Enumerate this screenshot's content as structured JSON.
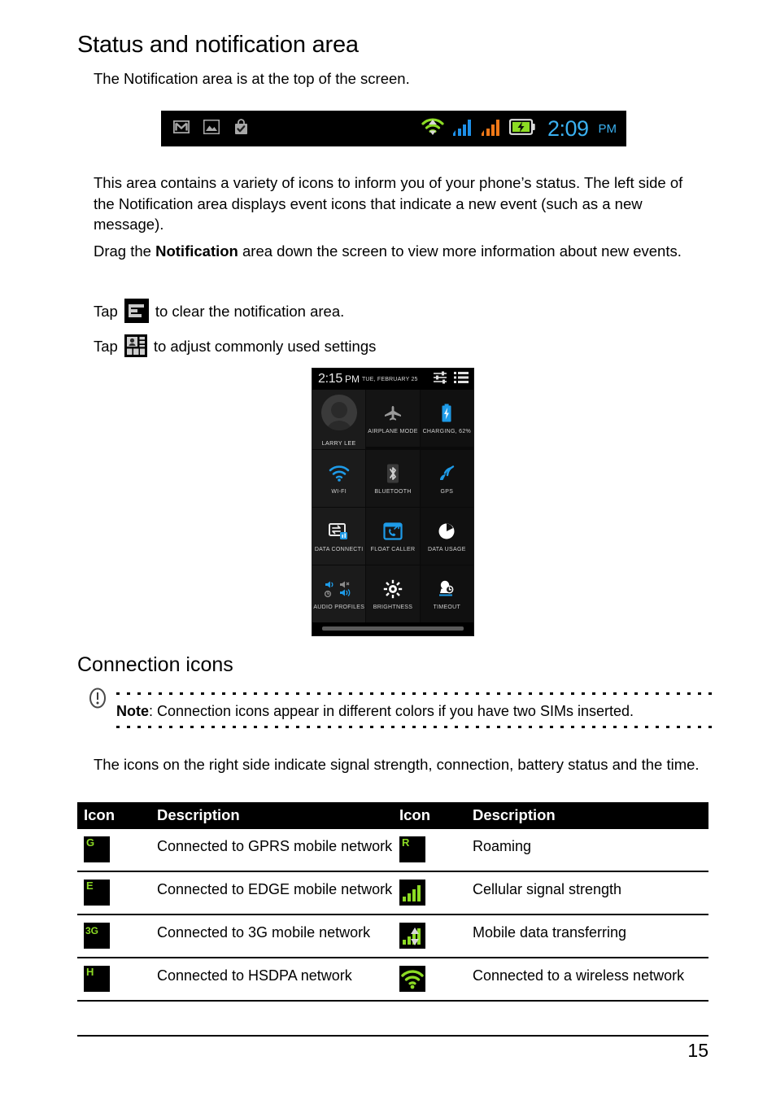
{
  "document": {
    "title": "Status and notification area",
    "intro": "The Notification area is at the top of the screen.",
    "paragraph_1": "This area contains a variety of icons to inform you of your phone’s status. The left side of the Notification area displays event icons that indicate a new event (such as a new message).",
    "paragraph_2_prefix": "Drag the ",
    "paragraph_2_bold": "Notification",
    "paragraph_2_suffix": " area down the screen to view more information about new events.",
    "tap_prefix": "Tap",
    "tap_clear_text": "to clear the notification area.",
    "tap_settings_text": "to adjust commonly used settings",
    "section_title": "Connection icons",
    "note_label": "Note",
    "note_text": ": Connection icons appear in different colors if you have two SIMs inserted.",
    "after_note": "The icons on the right side indicate signal strength, connection, battery status and the time.",
    "page_number": "15"
  },
  "statusbar": {
    "time": "2:09",
    "ampm": "PM",
    "time_color": "#3ab0f0",
    "left_icons": [
      "gmail-icon",
      "gallery-icon",
      "play-store-bag-icon"
    ],
    "right_icons": [
      "wifi-icon",
      "signal-sim1-icon",
      "signal-sim2-icon",
      "battery-charging-icon"
    ],
    "wifi_color": "#8cdb24",
    "sim1_color": "#1e90e8",
    "sim2_color": "#f07818",
    "battery_color": "#8cdb24"
  },
  "quick_settings": {
    "time": "2:15",
    "ampm": "PM",
    "date": "TUE, FEBRUARY 25",
    "header_icons": [
      "settings-sliders-icon",
      "notification-list-icon"
    ],
    "tiles": [
      {
        "label": "LARRY LEE",
        "icon": "user-avatar-icon",
        "accent": "#9a9a9a"
      },
      {
        "label": "AIRPLANE MODE",
        "icon": "airplane-icon",
        "accent": "#9a9a9a"
      },
      {
        "label": "CHARGING, 62%",
        "icon": "battery-charging-icon",
        "accent": "#1e9be8"
      },
      {
        "label": "WI-FI",
        "icon": "wifi-icon",
        "accent": "#1e9be8"
      },
      {
        "label": "BLUETOOTH",
        "icon": "bluetooth-icon",
        "accent": "#8a8a8a"
      },
      {
        "label": "GPS",
        "icon": "gps-icon",
        "accent": "#1e9be8"
      },
      {
        "label": "DATA CONNECTI",
        "icon": "data-connection-icon",
        "accent": "#e8e8e8"
      },
      {
        "label": "FLOAT CALLER",
        "icon": "float-caller-icon",
        "accent": "#1e9be8"
      },
      {
        "label": "DATA USAGE",
        "icon": "data-usage-icon",
        "accent": "#ffffff"
      },
      {
        "label": "AUDIO PROFILES",
        "icon": "audio-profiles-icon",
        "accent": "#1e9be8"
      },
      {
        "label": "BRIGHTNESS",
        "icon": "brightness-icon",
        "accent": "#ffffff"
      },
      {
        "label": "TIMEOUT",
        "icon": "timeout-icon",
        "accent": "#ffffff"
      }
    ]
  },
  "icon_table": {
    "headers": [
      "Icon",
      "Description",
      "Icon",
      "Description"
    ],
    "rows": [
      {
        "left_icon": "gprs-icon",
        "left_glyph": "G",
        "left_desc": "Connected to GPRS mobile network",
        "right_icon": "roaming-icon",
        "right_glyph": "R",
        "right_desc": "Roaming"
      },
      {
        "left_icon": "edge-icon",
        "left_glyph": "E",
        "left_desc": "Connected to EDGE mobile network",
        "right_icon": "signal-strength-icon",
        "right_glyph": "",
        "right_desc": "Cellular signal strength"
      },
      {
        "left_icon": "3g-icon",
        "left_glyph": "3G",
        "left_desc": "Connected to 3G mobile network",
        "right_icon": "data-transfer-icon",
        "right_glyph": "",
        "right_desc": "Mobile data transferring"
      },
      {
        "left_icon": "hsdpa-icon",
        "left_glyph": "H",
        "left_desc": "Connected to HSDPA network",
        "right_icon": "wifi-connected-icon",
        "right_glyph": "",
        "right_desc": "Connected to a wireless network"
      }
    ],
    "icon_green": "#8cdb24",
    "icon_background": "#000000"
  }
}
